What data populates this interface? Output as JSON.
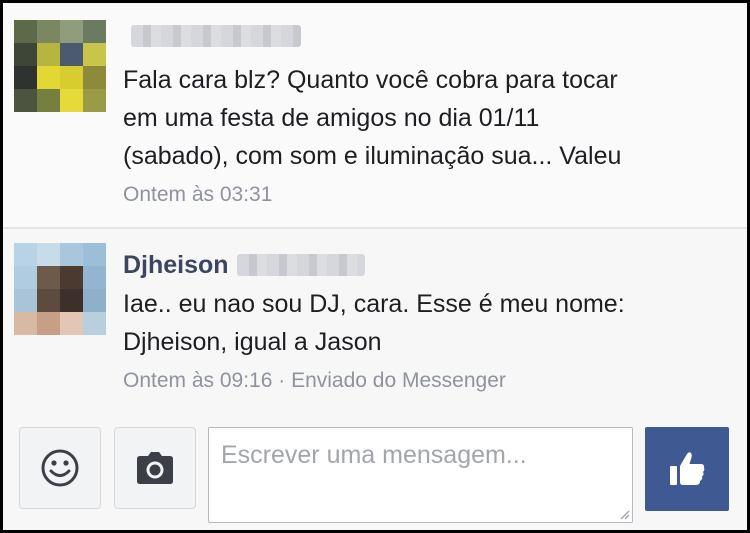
{
  "messages": [
    {
      "sender_name": "",
      "text_lines": [
        "Fala cara blz? Quanto você cobra para tocar",
        "em uma festa de amigos no dia 01/11",
        "(sabado), com som e iluminação sua... Valeu"
      ],
      "timestamp": "Ontem às 03:31",
      "avatar_icon": "pixelated-avatar"
    },
    {
      "sender_name": "Djheison",
      "text_lines": [
        "Iae.. eu nao sou DJ, cara. Esse é meu nome:",
        "Djheison, igual a Jason"
      ],
      "timestamp": "Ontem às 09:16 · Enviado do Messenger",
      "avatar_icon": "pixelated-avatar"
    }
  ],
  "composer": {
    "placeholder": "Escrever uma mensagem...",
    "emoji_icon": "smiley-icon",
    "camera_icon": "camera-icon",
    "like_icon": "thumbs-up-icon"
  },
  "colors": {
    "like_button_bg": "#3f5a92",
    "sender_name": "#3b4660",
    "meta_text": "#8f939c"
  }
}
